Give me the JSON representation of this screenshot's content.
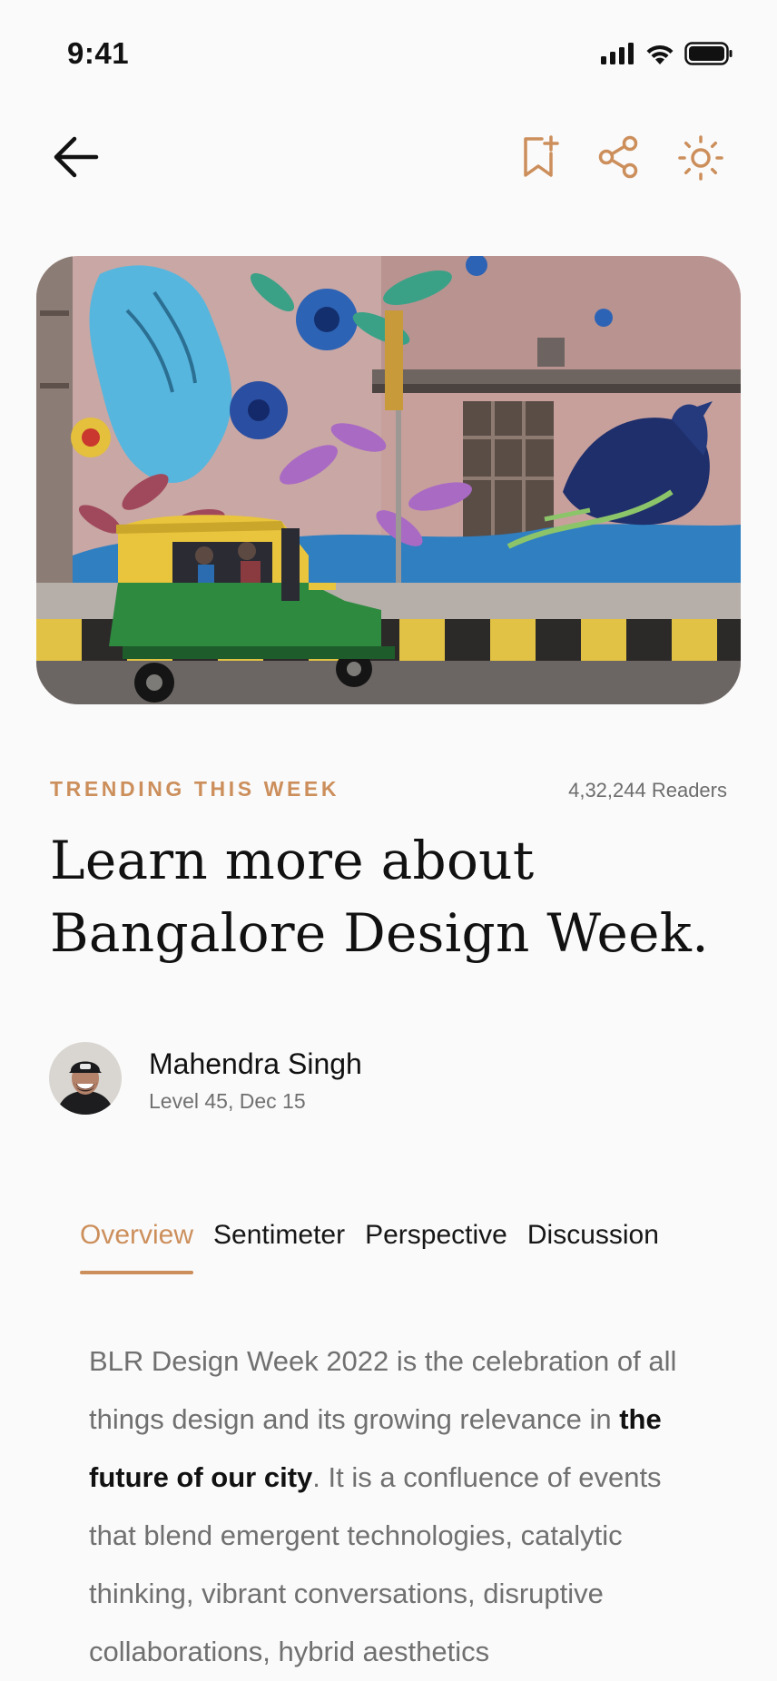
{
  "status": {
    "time": "9:41"
  },
  "topbar": {
    "back_icon": "arrow-left-icon",
    "bookmark_icon": "bookmark-add-icon",
    "share_icon": "share-icon",
    "theme_icon": "sun-icon",
    "accent_color": "#cc8f5c"
  },
  "hero": {
    "description": ""
  },
  "article": {
    "category": "TRENDING THIS WEEK",
    "readers": "4,32,244 Readers",
    "title_line1": "Learn more about",
    "title_line2": "Bangalore Design Week."
  },
  "author": {
    "name": "Mahendra Singh",
    "meta": "Level 45, Dec 15"
  },
  "tabs": [
    {
      "label": "Overview",
      "active": true
    },
    {
      "label": "Sentimeter",
      "active": false
    },
    {
      "label": "Perspective",
      "active": false
    },
    {
      "label": "Discussion",
      "active": false
    }
  ],
  "body": {
    "part1": "BLR Design Week 2022 is the celebration of all things design and its growing relevance in ",
    "highlight": "the future of our city",
    "part2": ". It is a confluence of events that blend emergent technologies, catalytic thinking, vibrant conversations, disruptive collaborations, hybrid aesthetics"
  }
}
